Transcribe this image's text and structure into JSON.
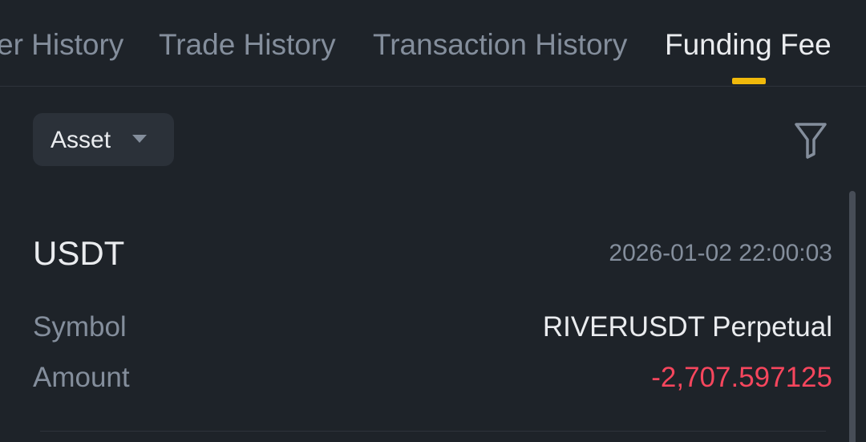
{
  "tabs": [
    {
      "label": "Order History",
      "active": false
    },
    {
      "label": "Trade History",
      "active": false
    },
    {
      "label": "Transaction History",
      "active": false
    },
    {
      "label": "Funding Fee",
      "active": true
    }
  ],
  "filters": {
    "asset_label": "Asset",
    "asset_dropdown_icon": "caret-down-icon",
    "filter_icon": "filter-funnel-icon"
  },
  "record": {
    "asset": "USDT",
    "timestamp": "2026-01-02 22:00:03",
    "symbol_label": "Symbol",
    "symbol_value": "RIVERUSDT Perpetual",
    "amount_label": "Amount",
    "amount_value": "-2,707.597125"
  },
  "colors": {
    "background": "#1e2329",
    "accent": "#f0b90b",
    "negative": "#f6465d",
    "muted_text": "#848e9c",
    "primary_text": "#eaecef"
  }
}
